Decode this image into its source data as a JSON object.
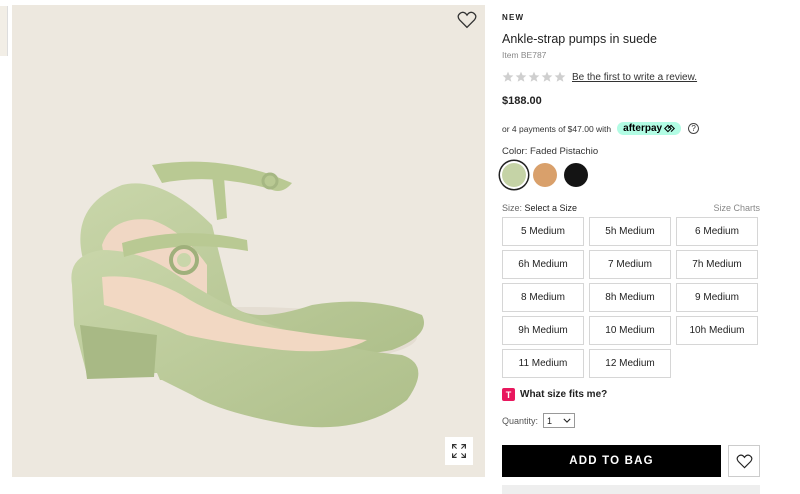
{
  "product": {
    "badge": "NEW",
    "title": "Ankle-strap pumps in suede",
    "item_number": "Item BE787",
    "review_link": "Be the first to write a review.",
    "price": "$188.00"
  },
  "afterpay": {
    "text": "or 4 payments of $47.00 with",
    "brand": "afterpay",
    "brand_icon": "afterpay-arrows-icon",
    "info_icon": "info-icon"
  },
  "color": {
    "label": "Color:",
    "selected": "Faded Pistachio",
    "swatches": [
      {
        "hex": "#c5d3a6"
      },
      {
        "hex": "#d9a06b"
      },
      {
        "hex": "#141414"
      }
    ]
  },
  "size": {
    "label": "Size:",
    "selected": "Select a Size",
    "charts_link": "Size Charts",
    "options": [
      "5 Medium",
      "5h Medium",
      "6 Medium",
      "6h Medium",
      "7 Medium",
      "7h Medium",
      "8 Medium",
      "8h Medium",
      "9 Medium",
      "9h Medium",
      "10 Medium",
      "10h Medium",
      "11 Medium",
      "12 Medium"
    ]
  },
  "fit": {
    "icon_letter": "T",
    "label": "What size fits me?"
  },
  "quantity": {
    "label": "Quantity:",
    "value": "1"
  },
  "actions": {
    "add_to_bag": "ADD TO BAG"
  },
  "icons": {
    "favorite": "heart-icon",
    "zoom": "expand-icon"
  },
  "colors": {
    "accent": "#000000",
    "afterpay_mint": "#b2fce4",
    "fit_brand": "#e8185e"
  }
}
